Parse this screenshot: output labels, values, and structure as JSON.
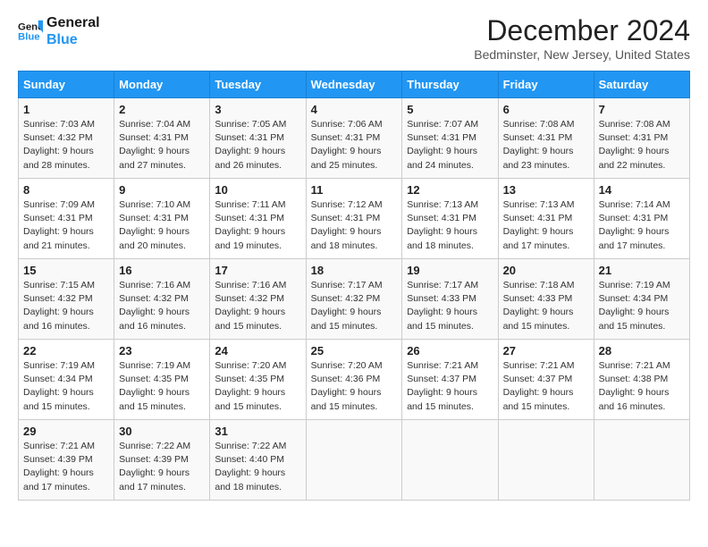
{
  "header": {
    "logo_line1": "General",
    "logo_line2": "Blue",
    "month_title": "December 2024",
    "location": "Bedminster, New Jersey, United States"
  },
  "days_of_week": [
    "Sunday",
    "Monday",
    "Tuesday",
    "Wednesday",
    "Thursday",
    "Friday",
    "Saturday"
  ],
  "weeks": [
    [
      {
        "day": "1",
        "sunrise": "7:03 AM",
        "sunset": "4:32 PM",
        "daylight": "9 hours and 28 minutes."
      },
      {
        "day": "2",
        "sunrise": "7:04 AM",
        "sunset": "4:31 PM",
        "daylight": "9 hours and 27 minutes."
      },
      {
        "day": "3",
        "sunrise": "7:05 AM",
        "sunset": "4:31 PM",
        "daylight": "9 hours and 26 minutes."
      },
      {
        "day": "4",
        "sunrise": "7:06 AM",
        "sunset": "4:31 PM",
        "daylight": "9 hours and 25 minutes."
      },
      {
        "day": "5",
        "sunrise": "7:07 AM",
        "sunset": "4:31 PM",
        "daylight": "9 hours and 24 minutes."
      },
      {
        "day": "6",
        "sunrise": "7:08 AM",
        "sunset": "4:31 PM",
        "daylight": "9 hours and 23 minutes."
      },
      {
        "day": "7",
        "sunrise": "7:08 AM",
        "sunset": "4:31 PM",
        "daylight": "9 hours and 22 minutes."
      }
    ],
    [
      {
        "day": "8",
        "sunrise": "7:09 AM",
        "sunset": "4:31 PM",
        "daylight": "9 hours and 21 minutes."
      },
      {
        "day": "9",
        "sunrise": "7:10 AM",
        "sunset": "4:31 PM",
        "daylight": "9 hours and 20 minutes."
      },
      {
        "day": "10",
        "sunrise": "7:11 AM",
        "sunset": "4:31 PM",
        "daylight": "9 hours and 19 minutes."
      },
      {
        "day": "11",
        "sunrise": "7:12 AM",
        "sunset": "4:31 PM",
        "daylight": "9 hours and 18 minutes."
      },
      {
        "day": "12",
        "sunrise": "7:13 AM",
        "sunset": "4:31 PM",
        "daylight": "9 hours and 18 minutes."
      },
      {
        "day": "13",
        "sunrise": "7:13 AM",
        "sunset": "4:31 PM",
        "daylight": "9 hours and 17 minutes."
      },
      {
        "day": "14",
        "sunrise": "7:14 AM",
        "sunset": "4:31 PM",
        "daylight": "9 hours and 17 minutes."
      }
    ],
    [
      {
        "day": "15",
        "sunrise": "7:15 AM",
        "sunset": "4:32 PM",
        "daylight": "9 hours and 16 minutes."
      },
      {
        "day": "16",
        "sunrise": "7:16 AM",
        "sunset": "4:32 PM",
        "daylight": "9 hours and 16 minutes."
      },
      {
        "day": "17",
        "sunrise": "7:16 AM",
        "sunset": "4:32 PM",
        "daylight": "9 hours and 15 minutes."
      },
      {
        "day": "18",
        "sunrise": "7:17 AM",
        "sunset": "4:32 PM",
        "daylight": "9 hours and 15 minutes."
      },
      {
        "day": "19",
        "sunrise": "7:17 AM",
        "sunset": "4:33 PM",
        "daylight": "9 hours and 15 minutes."
      },
      {
        "day": "20",
        "sunrise": "7:18 AM",
        "sunset": "4:33 PM",
        "daylight": "9 hours and 15 minutes."
      },
      {
        "day": "21",
        "sunrise": "7:19 AM",
        "sunset": "4:34 PM",
        "daylight": "9 hours and 15 minutes."
      }
    ],
    [
      {
        "day": "22",
        "sunrise": "7:19 AM",
        "sunset": "4:34 PM",
        "daylight": "9 hours and 15 minutes."
      },
      {
        "day": "23",
        "sunrise": "7:19 AM",
        "sunset": "4:35 PM",
        "daylight": "9 hours and 15 minutes."
      },
      {
        "day": "24",
        "sunrise": "7:20 AM",
        "sunset": "4:35 PM",
        "daylight": "9 hours and 15 minutes."
      },
      {
        "day": "25",
        "sunrise": "7:20 AM",
        "sunset": "4:36 PM",
        "daylight": "9 hours and 15 minutes."
      },
      {
        "day": "26",
        "sunrise": "7:21 AM",
        "sunset": "4:37 PM",
        "daylight": "9 hours and 15 minutes."
      },
      {
        "day": "27",
        "sunrise": "7:21 AM",
        "sunset": "4:37 PM",
        "daylight": "9 hours and 15 minutes."
      },
      {
        "day": "28",
        "sunrise": "7:21 AM",
        "sunset": "4:38 PM",
        "daylight": "9 hours and 16 minutes."
      }
    ],
    [
      {
        "day": "29",
        "sunrise": "7:21 AM",
        "sunset": "4:39 PM",
        "daylight": "9 hours and 17 minutes."
      },
      {
        "day": "30",
        "sunrise": "7:22 AM",
        "sunset": "4:39 PM",
        "daylight": "9 hours and 17 minutes."
      },
      {
        "day": "31",
        "sunrise": "7:22 AM",
        "sunset": "4:40 PM",
        "daylight": "9 hours and 18 minutes."
      },
      null,
      null,
      null,
      null
    ]
  ],
  "labels": {
    "sunrise": "Sunrise:",
    "sunset": "Sunset:",
    "daylight": "Daylight:"
  }
}
